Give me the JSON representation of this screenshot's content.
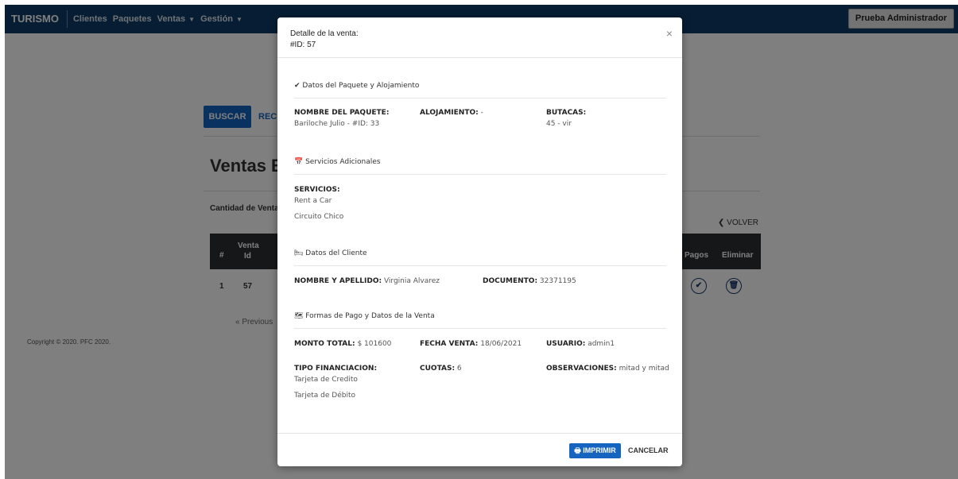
{
  "navbar": {
    "brand": "TURISMO",
    "items": [
      {
        "label": "Clientes",
        "caret": false
      },
      {
        "label": "Paquetes",
        "caret": false
      },
      {
        "label": "Ventas",
        "caret": true
      },
      {
        "label": "Gestión",
        "caret": true
      }
    ],
    "user_button": "Prueba Administrador"
  },
  "page": {
    "buscar": "BUSCAR",
    "rec": "REC",
    "title": "Ventas En",
    "cantidad": "Cantidad de Venta",
    "volver": "VOLVER",
    "table": {
      "headers": {
        "num": "#",
        "venta_1": "Venta",
        "venta_2": "Id",
        "pagos": "Pagos",
        "eliminar": "Eliminar"
      },
      "row": {
        "num": "1",
        "venta_id": "57"
      }
    },
    "previous": "« Previous",
    "copyright": "Copyright © 2020. PFC 2020."
  },
  "modal": {
    "title": "Detalle de la venta:",
    "subtitle": "#ID: 57",
    "close_icon": "×",
    "section_paquete": "Datos del Paquete y Alojamiento",
    "nombre_paquete_label": "NOMBRE DEL PAQUETE:",
    "nombre_paquete_value": "Bariloche Julio - #ID: 33",
    "alojamiento_label": "ALOJAMIENTO:",
    "alojamiento_value": " -",
    "butacas_label": "BUTACAS:",
    "butacas_value": "45 - vir",
    "section_servicios": "Servicios Adicionales",
    "servicios_label": "SERVICIOS:",
    "servicios": [
      "Rent a Car",
      "Circuito Chico"
    ],
    "section_cliente": "Datos del Cliente",
    "nombre_label": "NOMBRE Y APELLIDO:",
    "nombre_value": " Virginia Alvarez",
    "documento_label": "DOCUMENTO:",
    "documento_value": " 32371195",
    "section_pago": "Formas de Pago y Datos de la Venta",
    "monto_label": "MONTO TOTAL:",
    "monto_value": " $ 101600",
    "fecha_label": "FECHA VENTA:",
    "fecha_value": " 18/06/2021",
    "usuario_label": "USUARIO:",
    "usuario_value": " admin1",
    "tipo_label": "TIPO FINANCIACION:",
    "tipos": [
      "Tarjeta de Credito",
      "Tarjeta de Débito"
    ],
    "cuotas_label": "CUOTAS:",
    "cuotas_value": " 6",
    "observaciones_label": "OBSERVACIONES:",
    "observaciones_value": " mitad y mitad",
    "imprimir": "IMPRIMIR",
    "cancelar": "CANCELAR"
  },
  "colors": {
    "navbar": "#0c3b66",
    "primary": "#1565c0",
    "table_header": "#2b2f33"
  }
}
